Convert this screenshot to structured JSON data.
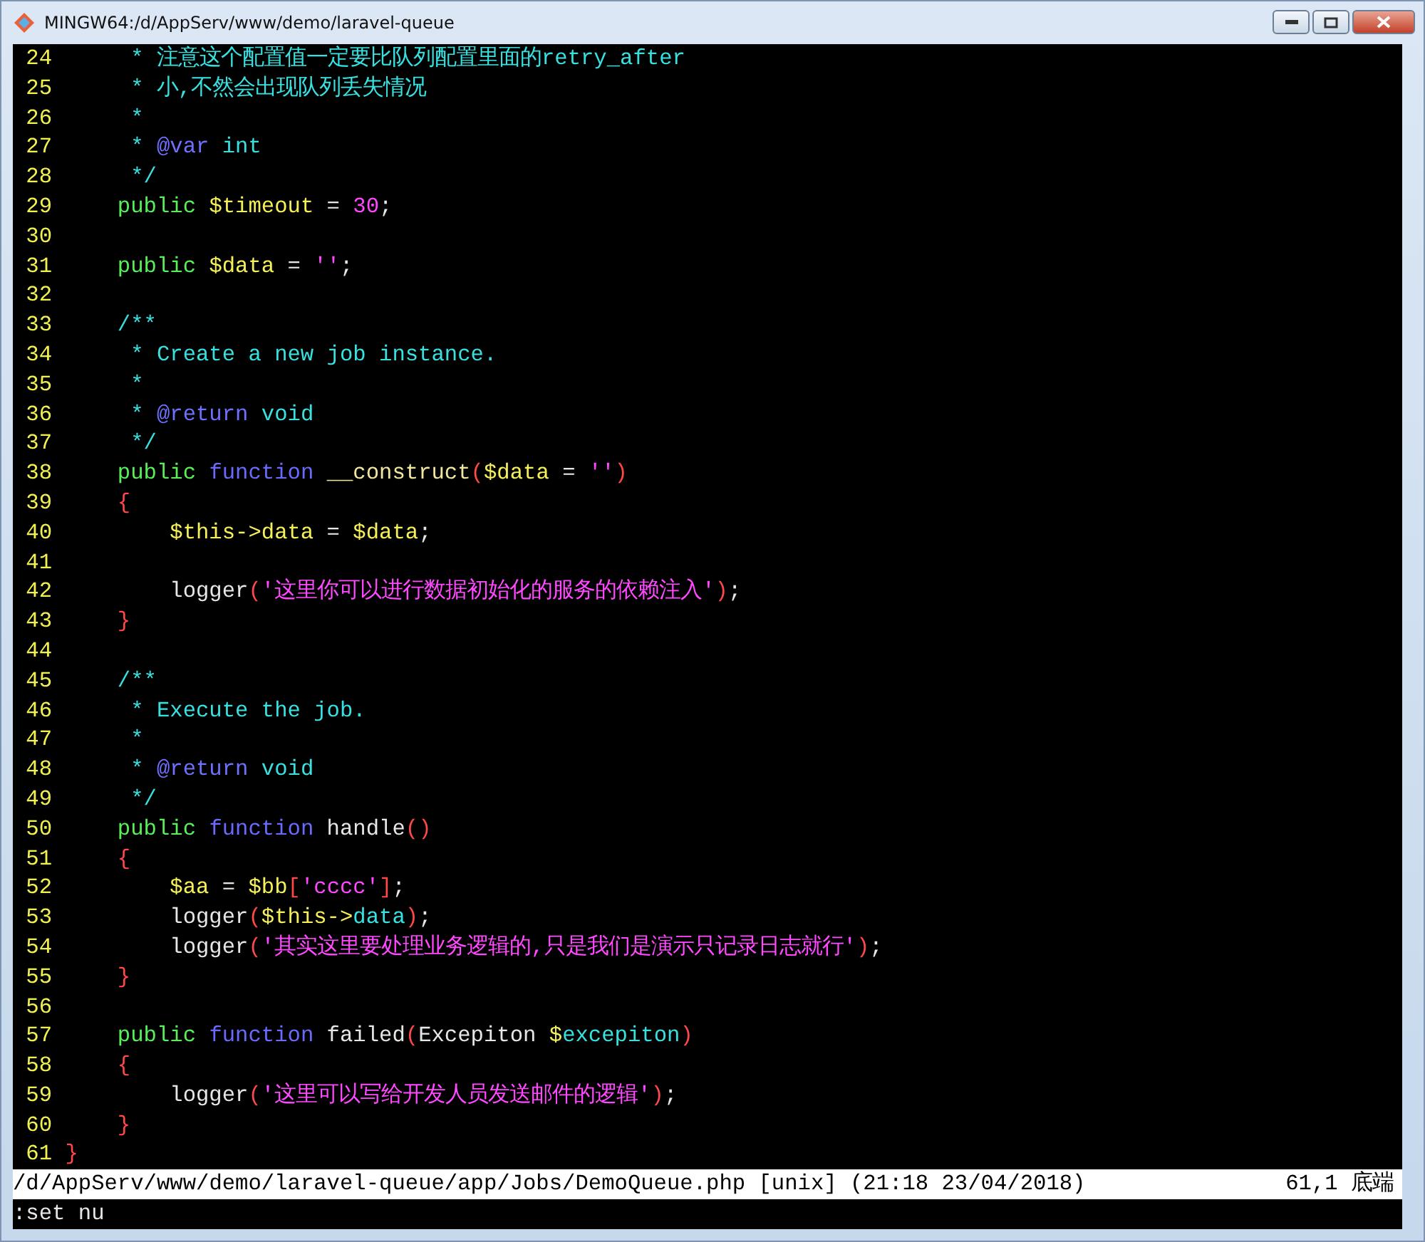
{
  "window": {
    "title": "MINGW64:/d/AppServ/www/demo/laravel-queue"
  },
  "editor": {
    "lines": [
      {
        "number": "24",
        "tokens": [
          {
            "text": "     * 注意这个配置值一定要比队列配置里面的retry_after",
            "kind": "comment"
          }
        ]
      },
      {
        "number": "25",
        "tokens": [
          {
            "text": "     * 小,不然会出现队列丢失情况",
            "kind": "comment"
          }
        ]
      },
      {
        "number": "26",
        "tokens": [
          {
            "text": "     *",
            "kind": "comment"
          }
        ]
      },
      {
        "number": "27",
        "tokens": [
          {
            "text": "     * ",
            "kind": "comment"
          },
          {
            "text": "@var",
            "kind": "tag"
          },
          {
            "text": " int",
            "kind": "comment"
          }
        ]
      },
      {
        "number": "28",
        "tokens": [
          {
            "text": "     */",
            "kind": "comment"
          }
        ]
      },
      {
        "number": "29",
        "tokens": [
          {
            "text": "    public ",
            "kind": "keyword"
          },
          {
            "text": "$timeout",
            "kind": "variable"
          },
          {
            "text": " = ",
            "kind": "plain"
          },
          {
            "text": "30",
            "kind": "string"
          },
          {
            "text": ";",
            "kind": "plain"
          }
        ]
      },
      {
        "number": "30"
      },
      {
        "number": "31",
        "tokens": [
          {
            "text": "    public ",
            "kind": "keyword"
          },
          {
            "text": "$data",
            "kind": "variable"
          },
          {
            "text": " = ",
            "kind": "plain"
          },
          {
            "text": "''",
            "kind": "string"
          },
          {
            "text": ";",
            "kind": "plain"
          }
        ]
      },
      {
        "number": "32"
      },
      {
        "number": "33",
        "tokens": [
          {
            "text": "    /**",
            "kind": "comment"
          }
        ]
      },
      {
        "number": "34",
        "tokens": [
          {
            "text": "     * Create a new job instance.",
            "kind": "comment"
          }
        ]
      },
      {
        "number": "35",
        "tokens": [
          {
            "text": "     *",
            "kind": "comment"
          }
        ]
      },
      {
        "number": "36",
        "tokens": [
          {
            "text": "     * ",
            "kind": "comment"
          },
          {
            "text": "@return",
            "kind": "tag"
          },
          {
            "text": " void",
            "kind": "comment"
          }
        ]
      },
      {
        "number": "37",
        "tokens": [
          {
            "text": "     */",
            "kind": "comment"
          }
        ]
      },
      {
        "number": "38",
        "tokens": [
          {
            "text": "    public ",
            "kind": "keyword"
          },
          {
            "text": "function ",
            "kind": "function"
          },
          {
            "text": "__construct",
            "kind": "identifier"
          },
          {
            "text": "(",
            "kind": "punct"
          },
          {
            "text": "$data",
            "kind": "variable"
          },
          {
            "text": " = ",
            "kind": "plain"
          },
          {
            "text": "''",
            "kind": "string"
          },
          {
            "text": ")",
            "kind": "punct"
          }
        ]
      },
      {
        "number": "39",
        "tokens": [
          {
            "text": "    {",
            "kind": "punct"
          }
        ]
      },
      {
        "number": "40",
        "tokens": [
          {
            "text": "        $this->data",
            "kind": "variable"
          },
          {
            "text": " = ",
            "kind": "plain"
          },
          {
            "text": "$data",
            "kind": "variable"
          },
          {
            "text": ";",
            "kind": "plain"
          }
        ]
      },
      {
        "number": "41"
      },
      {
        "number": "42",
        "tokens": [
          {
            "text": "        logger",
            "kind": "plain"
          },
          {
            "text": "(",
            "kind": "punct"
          },
          {
            "text": "'这里你可以进行数据初始化的服务的依赖注入'",
            "kind": "string"
          },
          {
            "text": ")",
            "kind": "punct"
          },
          {
            "text": ";",
            "kind": "plain"
          }
        ]
      },
      {
        "number": "43",
        "tokens": [
          {
            "text": "    }",
            "kind": "punct"
          }
        ]
      },
      {
        "number": "44"
      },
      {
        "number": "45",
        "tokens": [
          {
            "text": "    /**",
            "kind": "comment"
          }
        ]
      },
      {
        "number": "46",
        "tokens": [
          {
            "text": "     * Execute the job.",
            "kind": "comment"
          }
        ]
      },
      {
        "number": "47",
        "tokens": [
          {
            "text": "     *",
            "kind": "comment"
          }
        ]
      },
      {
        "number": "48",
        "tokens": [
          {
            "text": "     * ",
            "kind": "comment"
          },
          {
            "text": "@return",
            "kind": "tag"
          },
          {
            "text": " void",
            "kind": "comment"
          }
        ]
      },
      {
        "number": "49",
        "tokens": [
          {
            "text": "     */",
            "kind": "comment"
          }
        ]
      },
      {
        "number": "50",
        "tokens": [
          {
            "text": "    public ",
            "kind": "keyword"
          },
          {
            "text": "function",
            "kind": "function"
          },
          {
            "text": " handle",
            "kind": "plain"
          },
          {
            "text": "()",
            "kind": "punct"
          }
        ]
      },
      {
        "number": "51",
        "tokens": [
          {
            "text": "    {",
            "kind": "punct"
          }
        ]
      },
      {
        "number": "52",
        "tokens": [
          {
            "text": "        $aa",
            "kind": "variable"
          },
          {
            "text": " = ",
            "kind": "plain"
          },
          {
            "text": "$bb",
            "kind": "variable"
          },
          {
            "text": "[",
            "kind": "punct"
          },
          {
            "text": "'cccc'",
            "kind": "string"
          },
          {
            "text": "]",
            "kind": "punct"
          },
          {
            "text": ";",
            "kind": "plain"
          }
        ]
      },
      {
        "number": "53",
        "tokens": [
          {
            "text": "        logger",
            "kind": "plain"
          },
          {
            "text": "(",
            "kind": "punct"
          },
          {
            "text": "$this->",
            "kind": "variable"
          },
          {
            "text": "data",
            "kind": "comment"
          },
          {
            "text": ")",
            "kind": "punct"
          },
          {
            "text": ";",
            "kind": "plain"
          }
        ]
      },
      {
        "number": "54",
        "tokens": [
          {
            "text": "        logger",
            "kind": "plain"
          },
          {
            "text": "(",
            "kind": "punct"
          },
          {
            "text": "'其实这里要处理业务逻辑的,只是我们是演示只记录日志就行'",
            "kind": "string"
          },
          {
            "text": ")",
            "kind": "punct"
          },
          {
            "text": ";",
            "kind": "plain"
          }
        ]
      },
      {
        "number": "55",
        "tokens": [
          {
            "text": "    }",
            "kind": "punct"
          }
        ]
      },
      {
        "number": "56"
      },
      {
        "number": "57",
        "tokens": [
          {
            "text": "    public ",
            "kind": "keyword"
          },
          {
            "text": "function",
            "kind": "function"
          },
          {
            "text": " failed",
            "kind": "plain"
          },
          {
            "text": "(",
            "kind": "punct"
          },
          {
            "text": "Excepiton ",
            "kind": "plain"
          },
          {
            "text": "$",
            "kind": "variable"
          },
          {
            "text": "excepiton",
            "kind": "comment"
          },
          {
            "text": ")",
            "kind": "punct"
          }
        ]
      },
      {
        "number": "58",
        "tokens": [
          {
            "text": "    {",
            "kind": "punct"
          }
        ]
      },
      {
        "number": "59",
        "tokens": [
          {
            "text": "        logger",
            "kind": "plain"
          },
          {
            "text": "(",
            "kind": "punct"
          },
          {
            "text": "'这里可以写给开发人员发送邮件的逻辑'",
            "kind": "string"
          },
          {
            "text": ")",
            "kind": "punct"
          },
          {
            "text": ";",
            "kind": "plain"
          }
        ]
      },
      {
        "number": "60",
        "tokens": [
          {
            "text": "    }",
            "kind": "punct"
          }
        ]
      },
      {
        "number": "61",
        "tokens": [
          {
            "text": "}",
            "kind": "punct"
          }
        ]
      }
    ]
  },
  "status_line": {
    "file": "/d/AppServ/www/demo/laravel-queue/app/Jobs/DemoQueue.php [unix] (21:18 23/04/2018)",
    "position": "61,1 底端"
  },
  "command_line": ":set nu"
}
